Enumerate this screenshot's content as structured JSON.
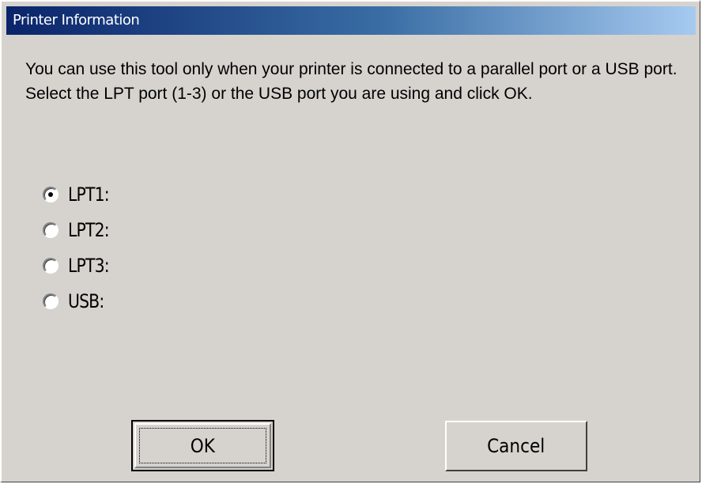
{
  "window": {
    "title": "Printer Information"
  },
  "message": "You can use this tool only when your printer is connected to a parallel port or a USB port. Select the LPT port (1-3) or the USB port you are using and click OK.",
  "ports": {
    "selected": "LPT1:",
    "options": [
      {
        "label": "LPT1:",
        "checked": true
      },
      {
        "label": "LPT2:",
        "checked": false
      },
      {
        "label": "LPT3:",
        "checked": false
      },
      {
        "label": "USB:",
        "checked": false
      }
    ]
  },
  "buttons": {
    "ok_label": "OK",
    "cancel_label": "Cancel"
  },
  "colors": {
    "dialog_face": "#d6d3ce",
    "title_start": "#0a246a",
    "title_end": "#a6caf0",
    "title_text": "#ffffff"
  }
}
